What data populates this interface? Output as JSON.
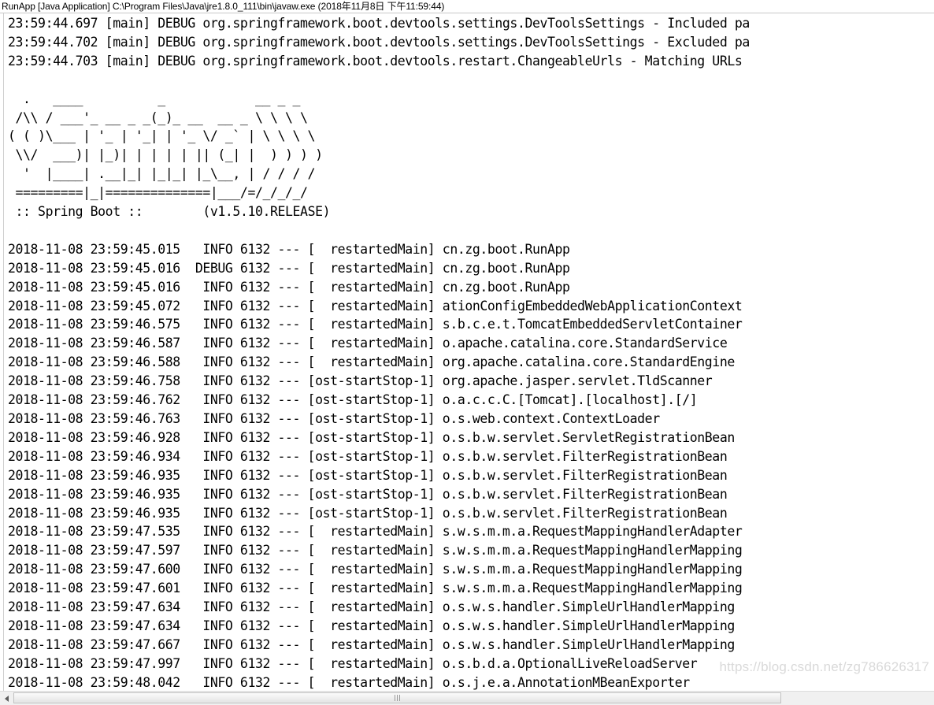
{
  "window": {
    "title": "RunApp [Java Application] C:\\Program Files\\Java\\jre1.8.0_111\\bin\\javaw.exe (2018年11月8日 下午11:59:44)"
  },
  "console": {
    "devtools_lines": "23:59:44.697 [main] DEBUG org.springframework.boot.devtools.settings.DevToolsSettings - Included pa\n23:59:44.702 [main] DEBUG org.springframework.boot.devtools.settings.DevToolsSettings - Excluded pa\n23:59:44.703 [main] DEBUG org.springframework.boot.devtools.restart.ChangeableUrls - Matching URLs",
    "banner": "\n  .   ____          _            __ _ _\n /\\\\ / ___'_ __ _ _(_)_ __  __ _ \\ \\ \\ \\\n( ( )\\___ | '_ | '_| | '_ \\/ _` | \\ \\ \\ \\\n \\\\/  ___)| |_)| | | | | || (_| |  ) ) ) )\n  '  |____| .__|_| |_|_| |_\\__, | / / / /\n =========|_|==============|___/=/_/_/_/",
    "banner_footer_left": " :: Spring Boot :: ",
    "banner_version": "(v1.5.10.RELEASE)",
    "log_lines": [
      {
        "date": "2018-11-08",
        "time": "23:59:45.015",
        "level": "INFO",
        "pid": "6132",
        "sep": "---",
        "thread": "restartedMain",
        "logger": "cn.zg.boot.RunApp"
      },
      {
        "date": "2018-11-08",
        "time": "23:59:45.016",
        "level": "DEBUG",
        "pid": "6132",
        "sep": "---",
        "thread": "restartedMain",
        "logger": "cn.zg.boot.RunApp"
      },
      {
        "date": "2018-11-08",
        "time": "23:59:45.016",
        "level": "INFO",
        "pid": "6132",
        "sep": "---",
        "thread": "restartedMain",
        "logger": "cn.zg.boot.RunApp"
      },
      {
        "date": "2018-11-08",
        "time": "23:59:45.072",
        "level": "INFO",
        "pid": "6132",
        "sep": "---",
        "thread": "restartedMain",
        "logger": "ationConfigEmbeddedWebApplicationContext"
      },
      {
        "date": "2018-11-08",
        "time": "23:59:46.575",
        "level": "INFO",
        "pid": "6132",
        "sep": "---",
        "thread": "restartedMain",
        "logger": "s.b.c.e.t.TomcatEmbeddedServletContainer"
      },
      {
        "date": "2018-11-08",
        "time": "23:59:46.587",
        "level": "INFO",
        "pid": "6132",
        "sep": "---",
        "thread": "restartedMain",
        "logger": "o.apache.catalina.core.StandardService"
      },
      {
        "date": "2018-11-08",
        "time": "23:59:46.588",
        "level": "INFO",
        "pid": "6132",
        "sep": "---",
        "thread": "restartedMain",
        "logger": "org.apache.catalina.core.StandardEngine"
      },
      {
        "date": "2018-11-08",
        "time": "23:59:46.758",
        "level": "INFO",
        "pid": "6132",
        "sep": "---",
        "thread": "ost-startStop-1",
        "logger": "org.apache.jasper.servlet.TldScanner"
      },
      {
        "date": "2018-11-08",
        "time": "23:59:46.762",
        "level": "INFO",
        "pid": "6132",
        "sep": "---",
        "thread": "ost-startStop-1",
        "logger": "o.a.c.c.C.[Tomcat].[localhost].[/]"
      },
      {
        "date": "2018-11-08",
        "time": "23:59:46.763",
        "level": "INFO",
        "pid": "6132",
        "sep": "---",
        "thread": "ost-startStop-1",
        "logger": "o.s.web.context.ContextLoader"
      },
      {
        "date": "2018-11-08",
        "time": "23:59:46.928",
        "level": "INFO",
        "pid": "6132",
        "sep": "---",
        "thread": "ost-startStop-1",
        "logger": "o.s.b.w.servlet.ServletRegistrationBean"
      },
      {
        "date": "2018-11-08",
        "time": "23:59:46.934",
        "level": "INFO",
        "pid": "6132",
        "sep": "---",
        "thread": "ost-startStop-1",
        "logger": "o.s.b.w.servlet.FilterRegistrationBean"
      },
      {
        "date": "2018-11-08",
        "time": "23:59:46.935",
        "level": "INFO",
        "pid": "6132",
        "sep": "---",
        "thread": "ost-startStop-1",
        "logger": "o.s.b.w.servlet.FilterRegistrationBean"
      },
      {
        "date": "2018-11-08",
        "time": "23:59:46.935",
        "level": "INFO",
        "pid": "6132",
        "sep": "---",
        "thread": "ost-startStop-1",
        "logger": "o.s.b.w.servlet.FilterRegistrationBean"
      },
      {
        "date": "2018-11-08",
        "time": "23:59:46.935",
        "level": "INFO",
        "pid": "6132",
        "sep": "---",
        "thread": "ost-startStop-1",
        "logger": "o.s.b.w.servlet.FilterRegistrationBean"
      },
      {
        "date": "2018-11-08",
        "time": "23:59:47.535",
        "level": "INFO",
        "pid": "6132",
        "sep": "---",
        "thread": "restartedMain",
        "logger": "s.w.s.m.m.a.RequestMappingHandlerAdapter"
      },
      {
        "date": "2018-11-08",
        "time": "23:59:47.597",
        "level": "INFO",
        "pid": "6132",
        "sep": "---",
        "thread": "restartedMain",
        "logger": "s.w.s.m.m.a.RequestMappingHandlerMapping"
      },
      {
        "date": "2018-11-08",
        "time": "23:59:47.600",
        "level": "INFO",
        "pid": "6132",
        "sep": "---",
        "thread": "restartedMain",
        "logger": "s.w.s.m.m.a.RequestMappingHandlerMapping"
      },
      {
        "date": "2018-11-08",
        "time": "23:59:47.601",
        "level": "INFO",
        "pid": "6132",
        "sep": "---",
        "thread": "restartedMain",
        "logger": "s.w.s.m.m.a.RequestMappingHandlerMapping"
      },
      {
        "date": "2018-11-08",
        "time": "23:59:47.634",
        "level": "INFO",
        "pid": "6132",
        "sep": "---",
        "thread": "restartedMain",
        "logger": "o.s.w.s.handler.SimpleUrlHandlerMapping"
      },
      {
        "date": "2018-11-08",
        "time": "23:59:47.634",
        "level": "INFO",
        "pid": "6132",
        "sep": "---",
        "thread": "restartedMain",
        "logger": "o.s.w.s.handler.SimpleUrlHandlerMapping"
      },
      {
        "date": "2018-11-08",
        "time": "23:59:47.667",
        "level": "INFO",
        "pid": "6132",
        "sep": "---",
        "thread": "restartedMain",
        "logger": "o.s.w.s.handler.SimpleUrlHandlerMapping"
      },
      {
        "date": "2018-11-08",
        "time": "23:59:47.997",
        "level": "INFO",
        "pid": "6132",
        "sep": "---",
        "thread": "restartedMain",
        "logger": "o.s.b.d.a.OptionalLiveReloadServer"
      },
      {
        "date": "2018-11-08",
        "time": "23:59:48.042",
        "level": "INFO",
        "pid": "6132",
        "sep": "---",
        "thread": "restartedMain",
        "logger": "o.s.j.e.a.AnnotationMBeanExporter"
      }
    ]
  },
  "watermark": {
    "text": "https://blog.csdn.net/zg786626317"
  },
  "scrollbar": {
    "left_arrow": "◄",
    "grip": "|||"
  },
  "colors": {
    "background": "#ffffff",
    "text": "#000000",
    "titlebar_border": "#c8c8c8",
    "scrollbar_track": "#f0f0f0",
    "scrollbar_thumb": "#efefef",
    "watermark": "#d9d9d9"
  }
}
